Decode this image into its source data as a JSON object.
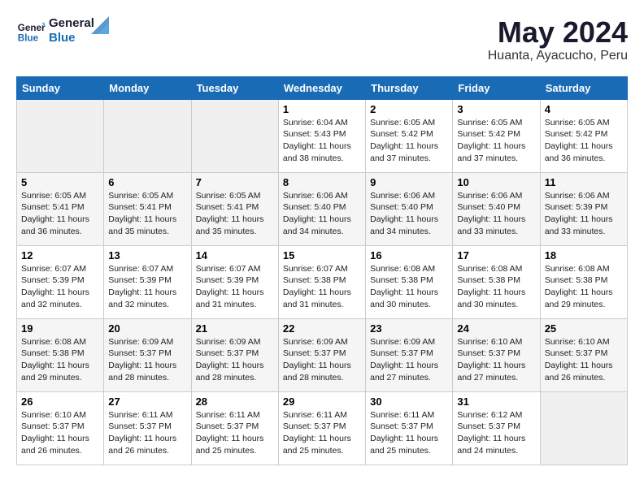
{
  "header": {
    "logo_line1": "General",
    "logo_line2": "Blue",
    "month": "May 2024",
    "location": "Huanta, Ayacucho, Peru"
  },
  "weekdays": [
    "Sunday",
    "Monday",
    "Tuesday",
    "Wednesday",
    "Thursday",
    "Friday",
    "Saturday"
  ],
  "weeks": [
    [
      {
        "num": "",
        "info": ""
      },
      {
        "num": "",
        "info": ""
      },
      {
        "num": "",
        "info": ""
      },
      {
        "num": "1",
        "info": "Sunrise: 6:04 AM\nSunset: 5:43 PM\nDaylight: 11 hours\nand 38 minutes."
      },
      {
        "num": "2",
        "info": "Sunrise: 6:05 AM\nSunset: 5:42 PM\nDaylight: 11 hours\nand 37 minutes."
      },
      {
        "num": "3",
        "info": "Sunrise: 6:05 AM\nSunset: 5:42 PM\nDaylight: 11 hours\nand 37 minutes."
      },
      {
        "num": "4",
        "info": "Sunrise: 6:05 AM\nSunset: 5:42 PM\nDaylight: 11 hours\nand 36 minutes."
      }
    ],
    [
      {
        "num": "5",
        "info": "Sunrise: 6:05 AM\nSunset: 5:41 PM\nDaylight: 11 hours\nand 36 minutes."
      },
      {
        "num": "6",
        "info": "Sunrise: 6:05 AM\nSunset: 5:41 PM\nDaylight: 11 hours\nand 35 minutes."
      },
      {
        "num": "7",
        "info": "Sunrise: 6:05 AM\nSunset: 5:41 PM\nDaylight: 11 hours\nand 35 minutes."
      },
      {
        "num": "8",
        "info": "Sunrise: 6:06 AM\nSunset: 5:40 PM\nDaylight: 11 hours\nand 34 minutes."
      },
      {
        "num": "9",
        "info": "Sunrise: 6:06 AM\nSunset: 5:40 PM\nDaylight: 11 hours\nand 34 minutes."
      },
      {
        "num": "10",
        "info": "Sunrise: 6:06 AM\nSunset: 5:40 PM\nDaylight: 11 hours\nand 33 minutes."
      },
      {
        "num": "11",
        "info": "Sunrise: 6:06 AM\nSunset: 5:39 PM\nDaylight: 11 hours\nand 33 minutes."
      }
    ],
    [
      {
        "num": "12",
        "info": "Sunrise: 6:07 AM\nSunset: 5:39 PM\nDaylight: 11 hours\nand 32 minutes."
      },
      {
        "num": "13",
        "info": "Sunrise: 6:07 AM\nSunset: 5:39 PM\nDaylight: 11 hours\nand 32 minutes."
      },
      {
        "num": "14",
        "info": "Sunrise: 6:07 AM\nSunset: 5:39 PM\nDaylight: 11 hours\nand 31 minutes."
      },
      {
        "num": "15",
        "info": "Sunrise: 6:07 AM\nSunset: 5:38 PM\nDaylight: 11 hours\nand 31 minutes."
      },
      {
        "num": "16",
        "info": "Sunrise: 6:08 AM\nSunset: 5:38 PM\nDaylight: 11 hours\nand 30 minutes."
      },
      {
        "num": "17",
        "info": "Sunrise: 6:08 AM\nSunset: 5:38 PM\nDaylight: 11 hours\nand 30 minutes."
      },
      {
        "num": "18",
        "info": "Sunrise: 6:08 AM\nSunset: 5:38 PM\nDaylight: 11 hours\nand 29 minutes."
      }
    ],
    [
      {
        "num": "19",
        "info": "Sunrise: 6:08 AM\nSunset: 5:38 PM\nDaylight: 11 hours\nand 29 minutes."
      },
      {
        "num": "20",
        "info": "Sunrise: 6:09 AM\nSunset: 5:37 PM\nDaylight: 11 hours\nand 28 minutes."
      },
      {
        "num": "21",
        "info": "Sunrise: 6:09 AM\nSunset: 5:37 PM\nDaylight: 11 hours\nand 28 minutes."
      },
      {
        "num": "22",
        "info": "Sunrise: 6:09 AM\nSunset: 5:37 PM\nDaylight: 11 hours\nand 28 minutes."
      },
      {
        "num": "23",
        "info": "Sunrise: 6:09 AM\nSunset: 5:37 PM\nDaylight: 11 hours\nand 27 minutes."
      },
      {
        "num": "24",
        "info": "Sunrise: 6:10 AM\nSunset: 5:37 PM\nDaylight: 11 hours\nand 27 minutes."
      },
      {
        "num": "25",
        "info": "Sunrise: 6:10 AM\nSunset: 5:37 PM\nDaylight: 11 hours\nand 26 minutes."
      }
    ],
    [
      {
        "num": "26",
        "info": "Sunrise: 6:10 AM\nSunset: 5:37 PM\nDaylight: 11 hours\nand 26 minutes."
      },
      {
        "num": "27",
        "info": "Sunrise: 6:11 AM\nSunset: 5:37 PM\nDaylight: 11 hours\nand 26 minutes."
      },
      {
        "num": "28",
        "info": "Sunrise: 6:11 AM\nSunset: 5:37 PM\nDaylight: 11 hours\nand 25 minutes."
      },
      {
        "num": "29",
        "info": "Sunrise: 6:11 AM\nSunset: 5:37 PM\nDaylight: 11 hours\nand 25 minutes."
      },
      {
        "num": "30",
        "info": "Sunrise: 6:11 AM\nSunset: 5:37 PM\nDaylight: 11 hours\nand 25 minutes."
      },
      {
        "num": "31",
        "info": "Sunrise: 6:12 AM\nSunset: 5:37 PM\nDaylight: 11 hours\nand 24 minutes."
      },
      {
        "num": "",
        "info": ""
      }
    ]
  ]
}
